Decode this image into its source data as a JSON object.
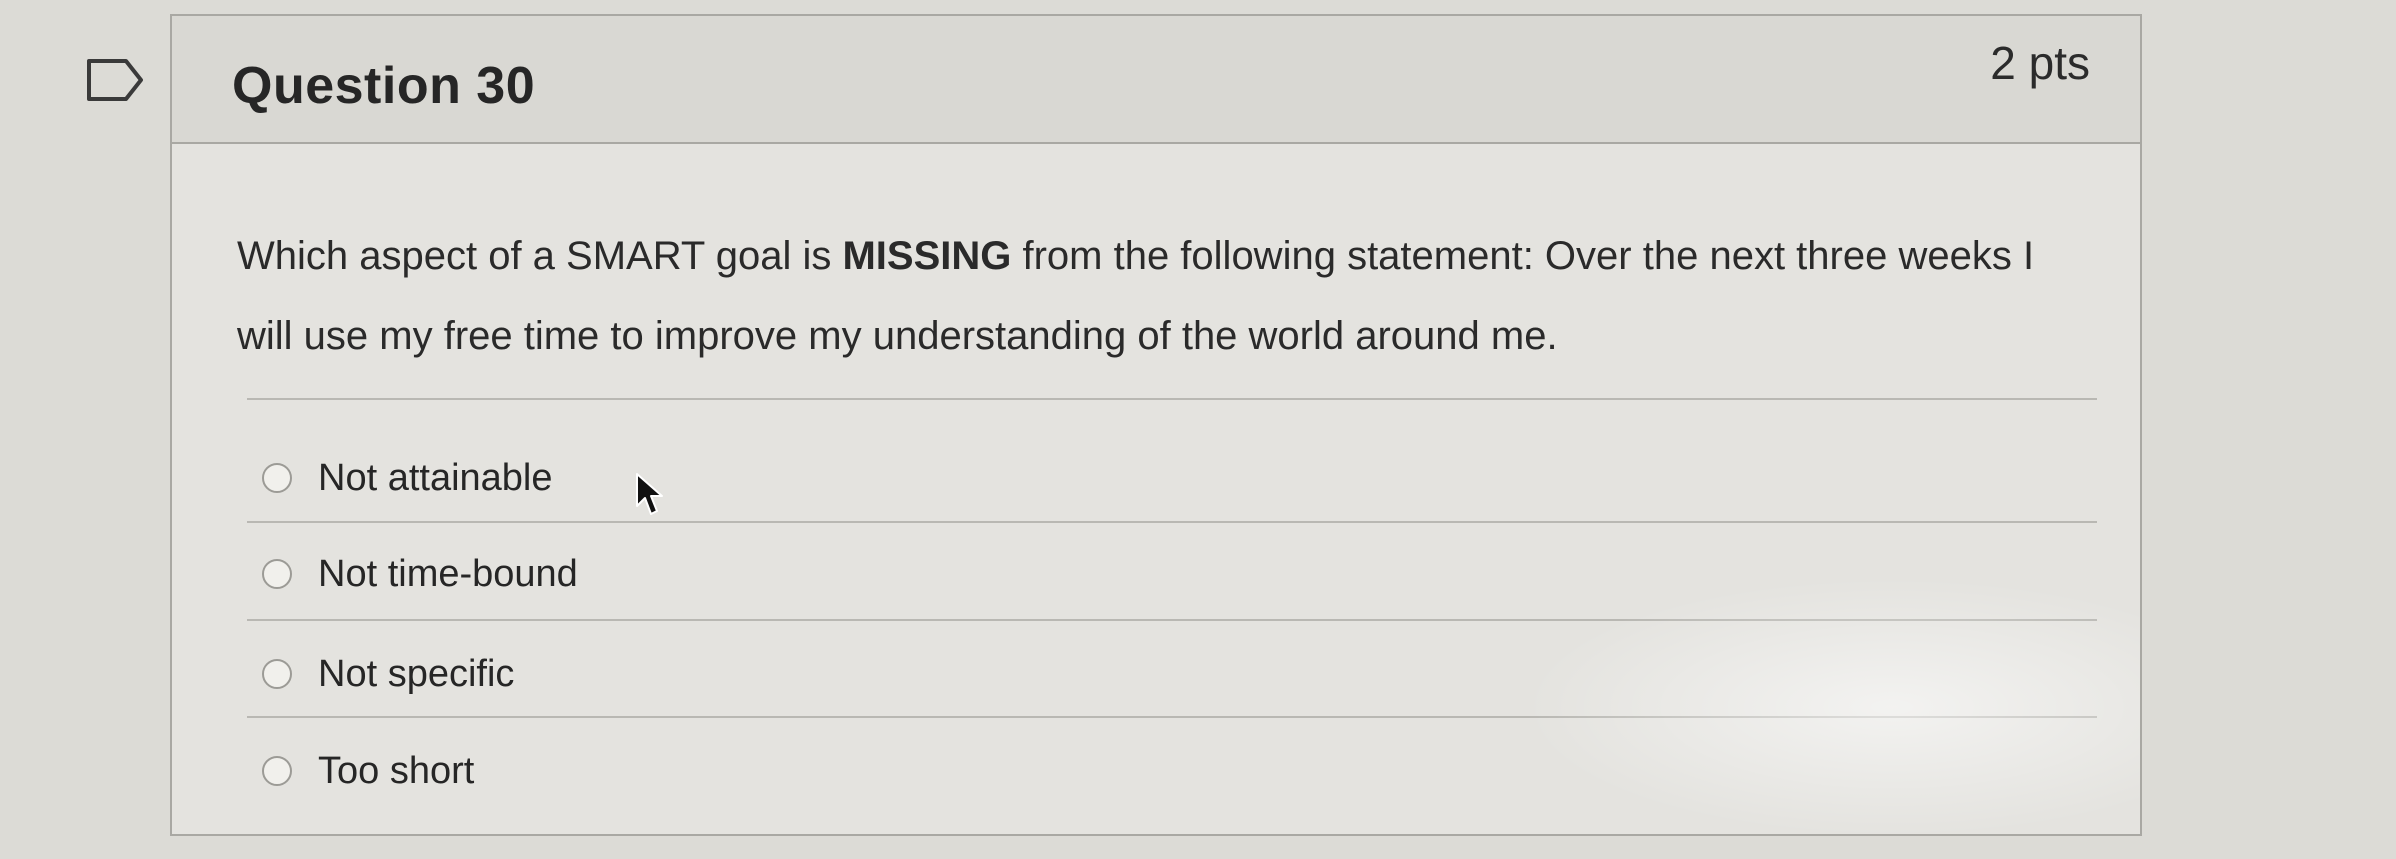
{
  "question": {
    "title": "Question 30",
    "points": "2 pts",
    "text_before": "Which aspect of a SMART goal is ",
    "text_bold": "MISSING",
    "text_after": " from the following statement: Over the next three weeks I will use my free time to improve my understanding of the world around me."
  },
  "answers": [
    {
      "label": "Not attainable"
    },
    {
      "label": "Not time-bound"
    },
    {
      "label": "Not specific"
    },
    {
      "label": "Too short"
    }
  ],
  "icons": {
    "flag": "flag-icon",
    "cursor": "mouse-pointer-icon",
    "radio": "radio-button-icon"
  },
  "colors": {
    "page_background": "#dcdbd6",
    "card_background": "#e4e3df",
    "header_background": "#d9d8d3",
    "border": "#a9a8a3",
    "text": "#262626"
  }
}
